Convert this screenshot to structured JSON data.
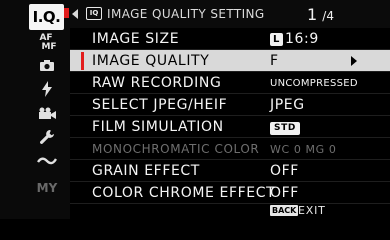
{
  "tabs": {
    "iq_label": "I.Q.",
    "af_label_top": "AF",
    "af_label_bottom": "MF",
    "my_label": "MY"
  },
  "header": {
    "badge": "IQ",
    "title": "IMAGE QUALITY SETTING",
    "page_current": "1",
    "page_total": "/4"
  },
  "menu": {
    "items": [
      {
        "label": "IMAGE SIZE",
        "value_badge": "L",
        "value": "16:9"
      },
      {
        "label": "IMAGE QUALITY",
        "value": "F"
      },
      {
        "label": "RAW RECORDING",
        "value": "UNCOMPRESSED"
      },
      {
        "label": "SELECT JPEG/HEIF",
        "value": "JPEG"
      },
      {
        "label": "FILM SIMULATION",
        "value_badge": "STD"
      },
      {
        "label": "MONOCHROMATIC COLOR",
        "value": "WC 0 MG 0"
      },
      {
        "label": "GRAIN EFFECT",
        "value": "OFF"
      },
      {
        "label": "COLOR CHROME EFFECT",
        "value": "OFF"
      }
    ]
  },
  "footer": {
    "back_badge": "BACK",
    "exit_label": "EXIT"
  },
  "colors": {
    "accent": "#e21c1c",
    "selection": "#d9d9d9",
    "background": "#000000"
  }
}
